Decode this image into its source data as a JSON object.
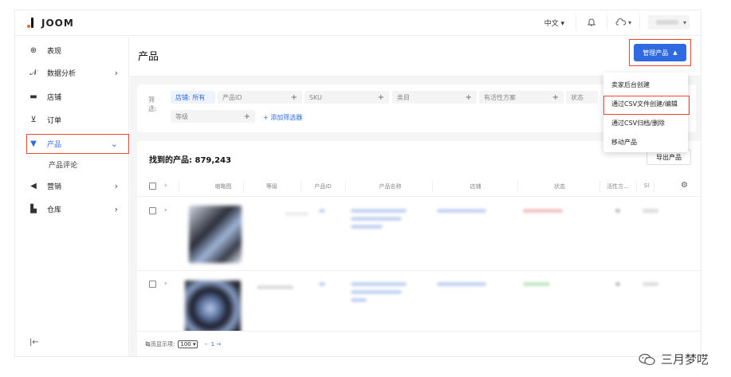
{
  "app": {
    "logo": "JOOM"
  },
  "topbar": {
    "language": "中文",
    "language_caret": "▾",
    "cloud_caret": "▾",
    "account_caret": "▾"
  },
  "sidebar": {
    "items": [
      {
        "label": "表现",
        "icon": "performance-icon"
      },
      {
        "label": "数据分析",
        "icon": "analytics-icon",
        "chevron": "›"
      },
      {
        "label": "店铺",
        "icon": "store-icon"
      },
      {
        "label": "订单",
        "icon": "cart-icon"
      },
      {
        "label": "产品",
        "icon": "product-icon",
        "chevron": "⌄",
        "active": true
      },
      {
        "label": "营销",
        "icon": "marketing-icon",
        "chevron": "›"
      },
      {
        "label": "仓库",
        "icon": "warehouse-icon",
        "chevron": "›"
      }
    ],
    "sub_item": "产品评论",
    "collapse": "|←"
  },
  "page": {
    "title": "产品",
    "manage_button": "管理产品",
    "manage_caret": "▲"
  },
  "dropdown": {
    "items": [
      "卖家后台创建",
      "通过CSV文件创建/编辑",
      "通过CSV归档/删除",
      "移动产品"
    ]
  },
  "filters": {
    "label": "筛选:",
    "chips": [
      {
        "text": "店铺: 所有",
        "plus": ""
      },
      {
        "text": "产品ID",
        "plus": "+"
      },
      {
        "text": "SKU",
        "plus": "+"
      },
      {
        "text": "类目",
        "plus": "+"
      },
      {
        "text": "有活性方案",
        "plus": "+"
      },
      {
        "text": "状态",
        "plus": ""
      },
      {
        "text": "等级",
        "plus": "+"
      }
    ],
    "add_filter": "+ 添加筛选器"
  },
  "results": {
    "found": "找到的产品: 879,243",
    "export": "导出产品",
    "columns": [
      "缩略图",
      "等级",
      "产品ID",
      "产品名称",
      "店铺",
      "状态",
      "活性方...",
      "Sl"
    ]
  },
  "footer": {
    "per_page_label": "每页显示项:",
    "per_page_value": "100 ▾",
    "pager_prev": "←",
    "pager_page": "1",
    "pager_next": "→"
  },
  "watermark": {
    "text": "三月梦呓"
  },
  "colors": {
    "accent": "#2f6ae0",
    "highlight": "#e8462e",
    "brand_dot": "#f06a1c"
  }
}
